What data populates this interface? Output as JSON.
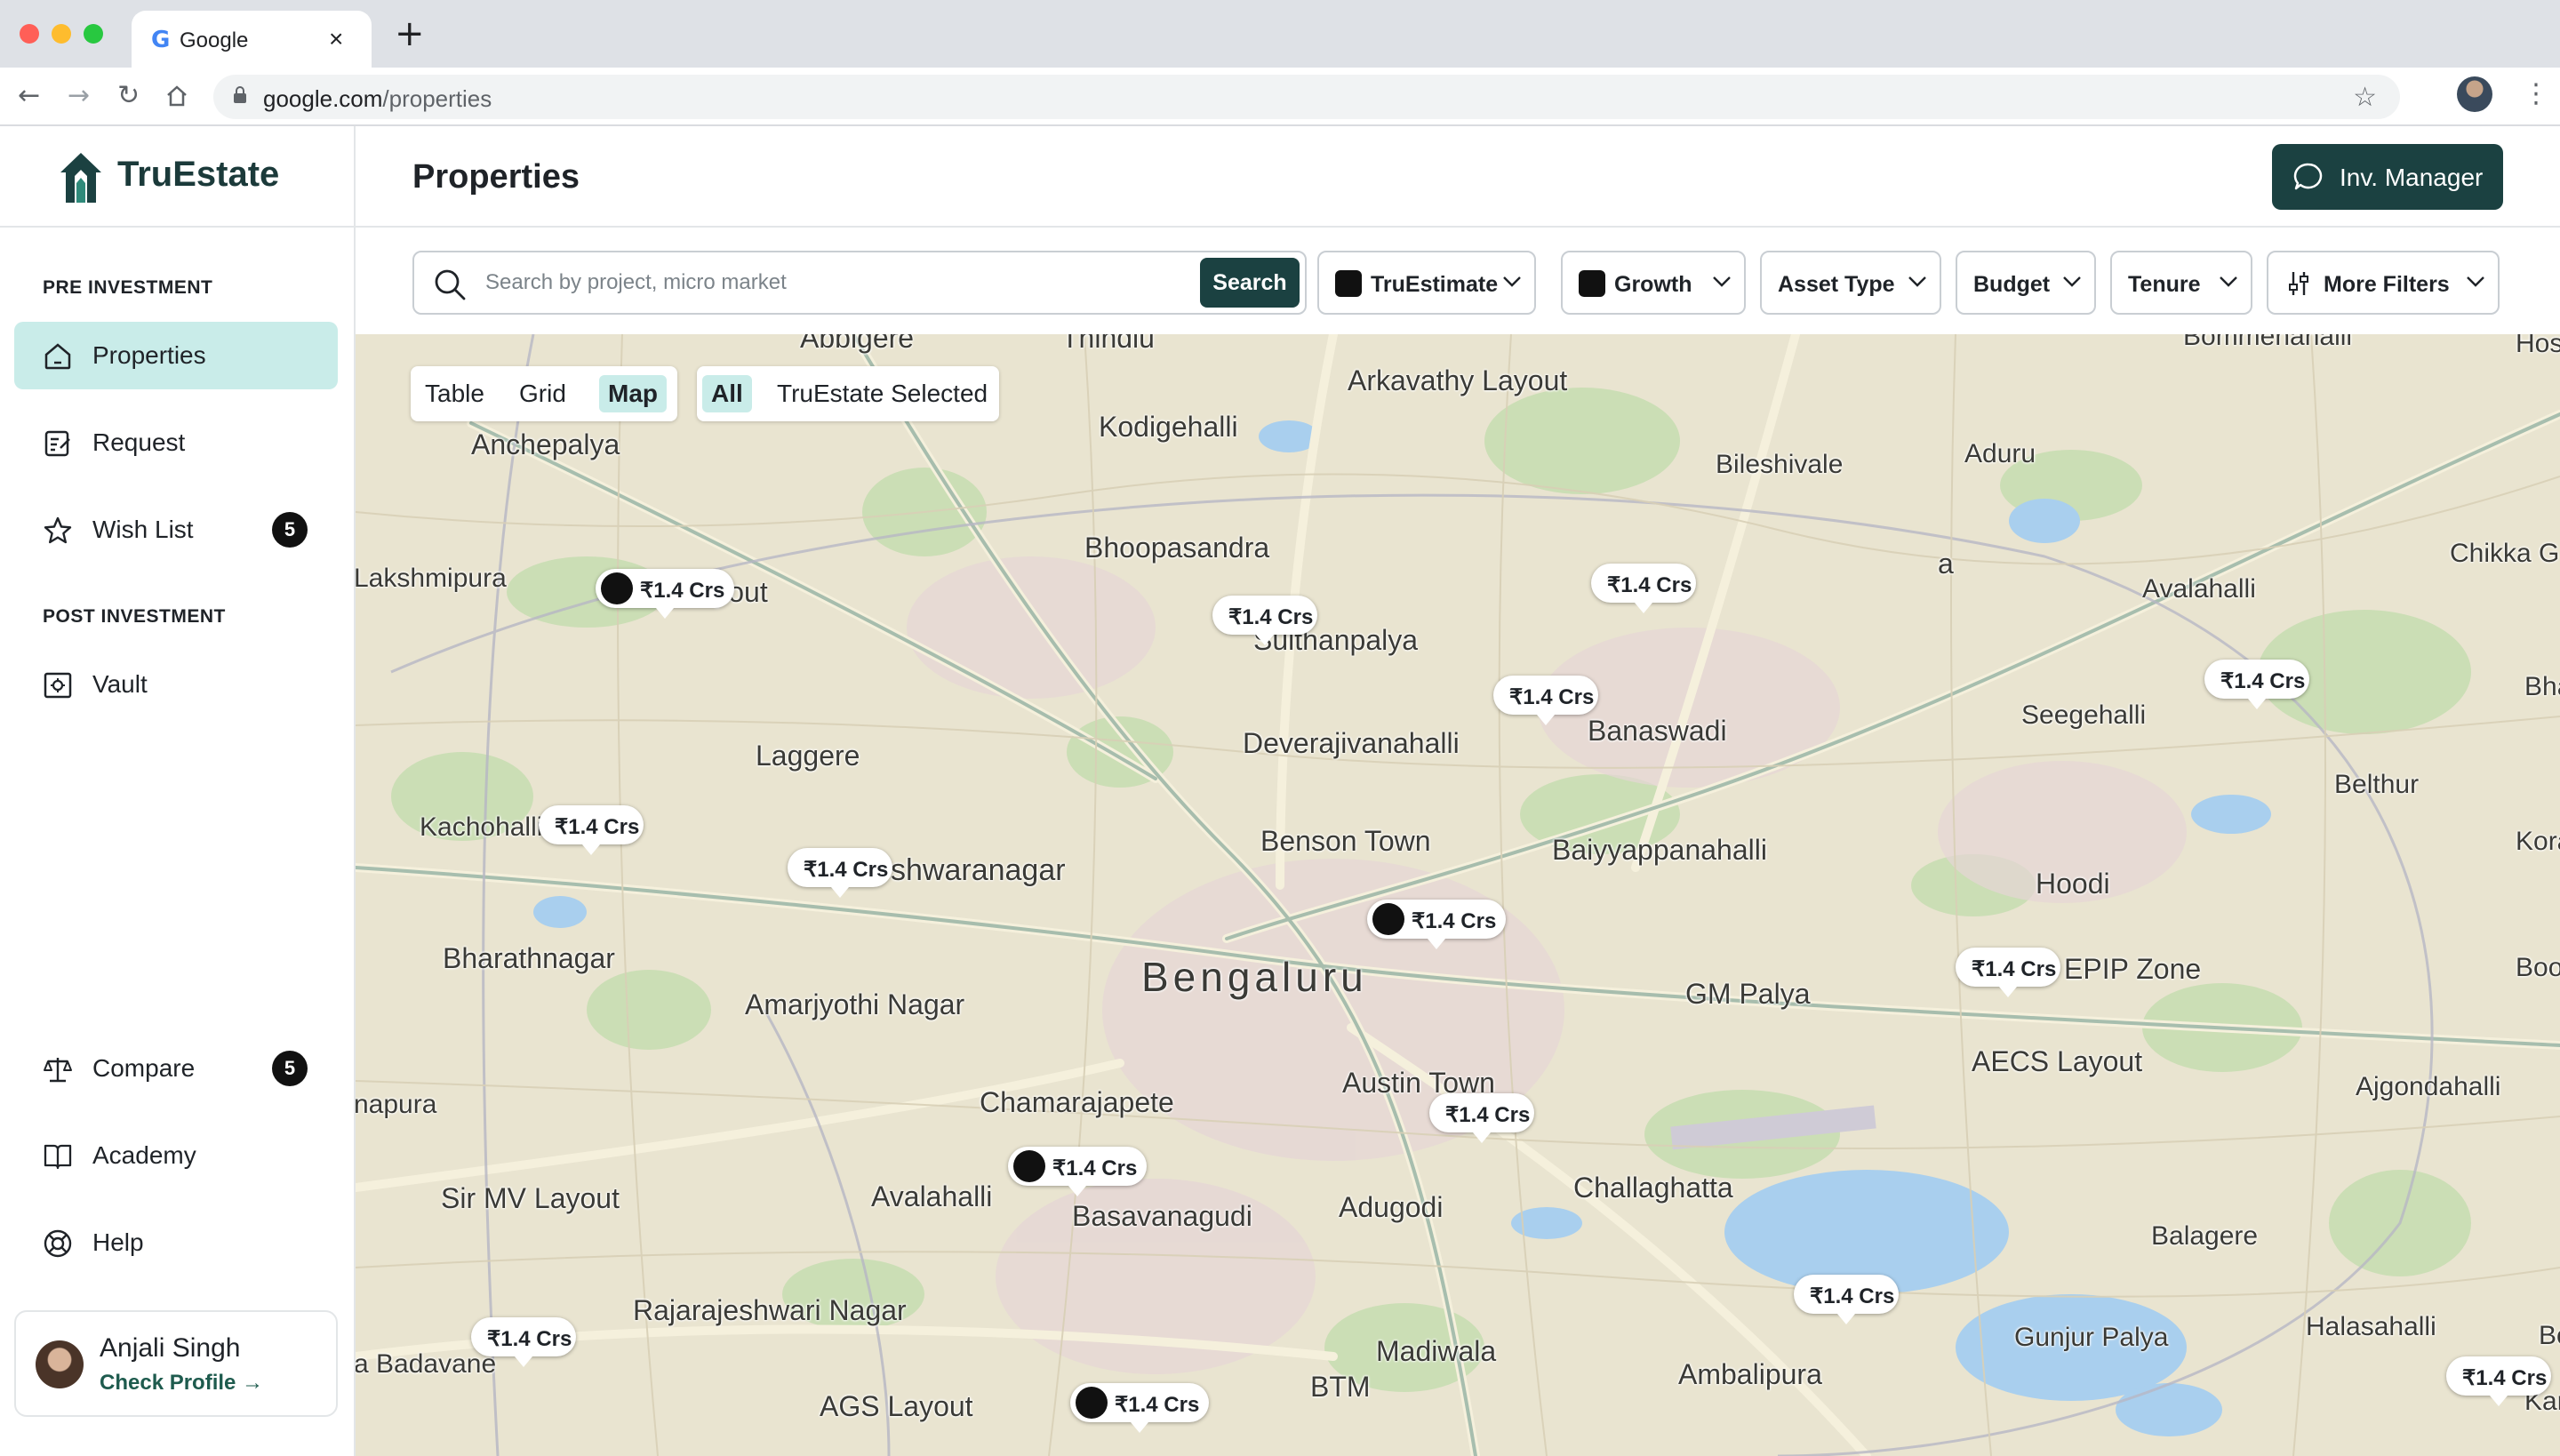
{
  "browser": {
    "tab_title": "Google",
    "favicon": "G",
    "close_glyph": "×",
    "new_tab_glyph": "+",
    "url_host": "google.com",
    "url_path": "/properties"
  },
  "app": {
    "brand": "TruEstate",
    "page_title": "Properties",
    "inv_manager_label": "Inv. Manager"
  },
  "sidebar": {
    "pre_investment_label": "PRE INVESTMENT",
    "post_investment_label": "POST INVESTMENT",
    "items": [
      {
        "label": "Properties",
        "icon": "home-icon",
        "active": true
      },
      {
        "label": "Request",
        "icon": "request-icon"
      },
      {
        "label": "Wish List",
        "icon": "star-icon",
        "badge": "5"
      },
      {
        "label": "Vault",
        "icon": "vault-icon"
      },
      {
        "label": "Compare",
        "icon": "scale-icon",
        "badge": "5"
      },
      {
        "label": "Academy",
        "icon": "book-icon"
      },
      {
        "label": "Help",
        "icon": "lifebuoy-icon"
      }
    ],
    "user": {
      "name": "Anjali Singh",
      "link": "Check Profile →"
    }
  },
  "filters": {
    "search_placeholder": "Search by project, micro market",
    "search_button": "Search",
    "dropdowns": [
      "TruEstimate",
      "Growth",
      "Asset Type",
      "Budget",
      "Tenure",
      "More Filters"
    ]
  },
  "map": {
    "view_modes": [
      "Table",
      "Grid",
      "Map"
    ],
    "active_view": "Map",
    "selection_modes": [
      "All",
      "TruEstate Selected"
    ],
    "active_selection": "All",
    "price_label": "₹1.4 Crs",
    "places": [
      "Abbigere",
      "Thindlu",
      "Arkavathy Layout",
      "Bommenahalli",
      "Hos",
      "Kodigehalli",
      "Anchepalya",
      "Bileshivale",
      "Aduru",
      "Lakshmipura",
      "HMT Layout",
      "Bhoopasandra",
      "Sulthanpalya",
      "a",
      "Avalahalli",
      "Chikka G",
      "Deverajivanahalli",
      "Banaswadi",
      "Seegehalli",
      "Bhakt",
      "Laggere",
      "Belthur",
      "Kachohalli",
      "Benson Town",
      "Baiyyappanahalli",
      "Koralur",
      "shwaranagar",
      "Hoodi",
      "Bharathnagar",
      "Bengaluru",
      "EPIP Zone",
      "Boo",
      "Amarjyothi Nagar",
      "GM Palya",
      "AECS Layout",
      "napura",
      "Chamarajapete",
      "Austin Town",
      "Ajgondahalli",
      "Sir MV Layout",
      "Avalahalli",
      "Basavanagudi",
      "Adugodi",
      "Challaghatta",
      "Balagere",
      "Rajarajeshwari Nagar",
      "Madiwala",
      "Halasahalli",
      "a Badavane",
      "Gunjur Palya",
      "Ambalipura",
      "AGS Layout",
      "BTM",
      "Kar",
      "Bo"
    ]
  },
  "colors": {
    "accent": "#1b4141",
    "active_bg": "#c9ece9",
    "map_land": "#e9e4d0",
    "map_park": "#c5ddb0",
    "map_water": "#a9cfee"
  }
}
